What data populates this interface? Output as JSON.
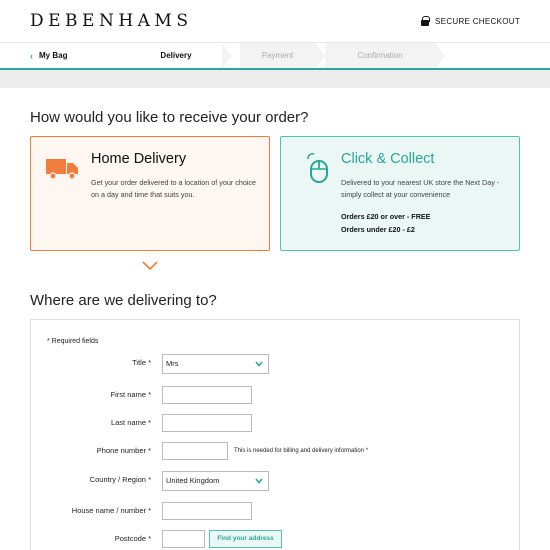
{
  "header": {
    "logo": "DEBENHAMS",
    "secure_label": "SECURE CHECKOUT",
    "secure_icon": "lock-icon"
  },
  "steps": {
    "back_label": "My Bag",
    "items": [
      {
        "label": "Delivery",
        "state": "active"
      },
      {
        "label": "Payment",
        "state": "upcoming"
      },
      {
        "label": "Confirmation",
        "state": "upcoming"
      }
    ]
  },
  "receive": {
    "heading": "How would you like to receive your order?",
    "home": {
      "title": "Home Delivery",
      "description": "Get your order delivered to a location of your choice on a day and time that suits you.",
      "icon": "van-icon",
      "selected": true
    },
    "click": {
      "title": "Click & Collect",
      "description": "Delivered to your nearest UK store the Next Day - simply collect at your convenience",
      "fee1": "Orders £20 or over - FREE",
      "fee2": "Orders under £20 - £2",
      "icon": "mouse-icon"
    }
  },
  "delivery": {
    "heading": "Where are we delivering to?",
    "required_note": "* Required fields",
    "fields": {
      "title_label": "Title *",
      "title_value": "Mrs",
      "first_name_label": "First name *",
      "first_name_value": "",
      "last_name_label": "Last name *",
      "last_name_value": "",
      "phone_label": "Phone number *",
      "phone_value": "",
      "phone_hint": "This is needed for billing and delivery information *",
      "country_label": "Country / Region *",
      "country_value": "United Kingdom",
      "house_label": "House name / number *",
      "house_value": "",
      "postcode_label": "Postcode *",
      "postcode_value": "",
      "find_button": "Find your address"
    }
  },
  "colors": {
    "accent_teal": "#2aa698",
    "accent_orange": "#f07c3e"
  }
}
